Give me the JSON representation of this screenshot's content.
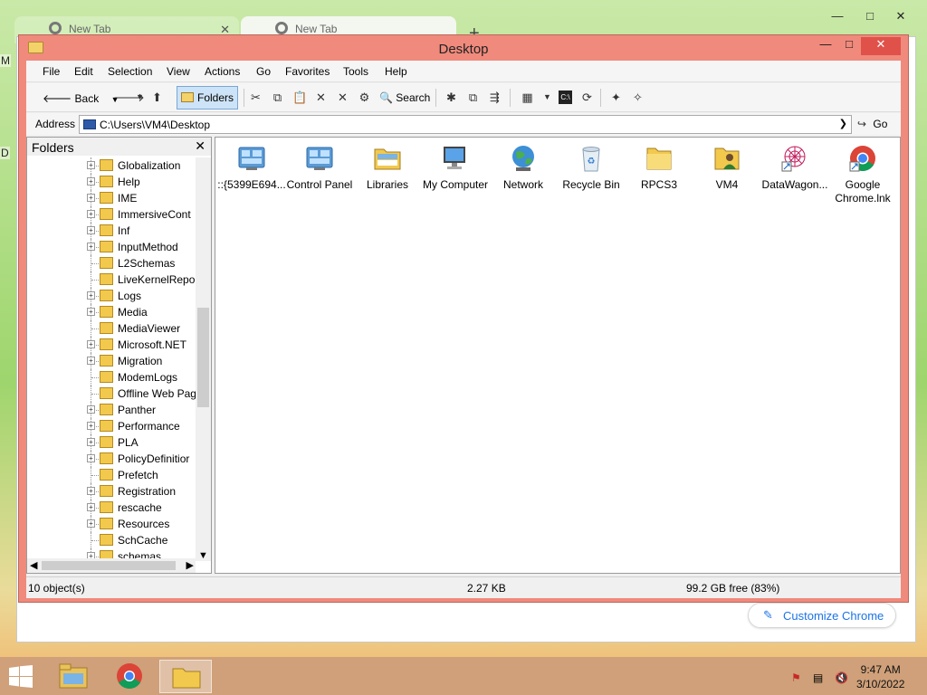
{
  "browser": {
    "tabs": [
      {
        "label": "New Tab"
      },
      {
        "label": "New Tab"
      }
    ],
    "new_tab_symbol": "+",
    "minimize_symbol": "—",
    "maximize_symbol": "□",
    "close_symbol": "✕",
    "dropdown_symbol": "⌄",
    "customize_label": "Customize Chrome"
  },
  "background_fragments": {
    "left_top": "M",
    "left_mid": "D"
  },
  "window": {
    "title": "Desktop",
    "menu": [
      "File",
      "Edit",
      "Selection",
      "View",
      "Actions",
      "Go",
      "Favorites",
      "Tools",
      "Help"
    ],
    "toolbar": {
      "back_label": "Back",
      "folders_label": "Folders",
      "search_label": "Search"
    },
    "address": {
      "label": "Address",
      "value": "C:\\Users\\VM4\\Desktop",
      "go_label": "Go"
    },
    "folders_pane": {
      "title": "Folders",
      "close_symbol": "✕",
      "tree": [
        {
          "label": "Globalization",
          "expandable": true
        },
        {
          "label": "Help",
          "expandable": true
        },
        {
          "label": "IME",
          "expandable": true
        },
        {
          "label": "ImmersiveCont",
          "expandable": true
        },
        {
          "label": "Inf",
          "expandable": true
        },
        {
          "label": "InputMethod",
          "expandable": true
        },
        {
          "label": "L2Schemas",
          "expandable": false
        },
        {
          "label": "LiveKernelRepo",
          "expandable": false
        },
        {
          "label": "Logs",
          "expandable": true
        },
        {
          "label": "Media",
          "expandable": true
        },
        {
          "label": "MediaViewer",
          "expandable": false
        },
        {
          "label": "Microsoft.NET",
          "expandable": true
        },
        {
          "label": "Migration",
          "expandable": true
        },
        {
          "label": "ModemLogs",
          "expandable": false
        },
        {
          "label": "Offline Web Pag",
          "expandable": false
        },
        {
          "label": "Panther",
          "expandable": true
        },
        {
          "label": "Performance",
          "expandable": true
        },
        {
          "label": "PLA",
          "expandable": true
        },
        {
          "label": "PolicyDefinitior",
          "expandable": true
        },
        {
          "label": "Prefetch",
          "expandable": false
        },
        {
          "label": "Registration",
          "expandable": true
        },
        {
          "label": "rescache",
          "expandable": true
        },
        {
          "label": "Resources",
          "expandable": true
        },
        {
          "label": "SchCache",
          "expandable": false
        },
        {
          "label": "schemas",
          "expandable": true
        }
      ]
    },
    "items": [
      {
        "label": "::{5399E694...",
        "icon": "control-panel-icon"
      },
      {
        "label": "Control Panel",
        "icon": "control-panel-icon"
      },
      {
        "label": "Libraries",
        "icon": "libraries-icon"
      },
      {
        "label": "My Computer",
        "icon": "computer-icon"
      },
      {
        "label": "Network",
        "icon": "network-icon"
      },
      {
        "label": "Recycle Bin",
        "icon": "recycle-bin-icon"
      },
      {
        "label": "RPCS3",
        "icon": "folder-icon"
      },
      {
        "label": "VM4",
        "icon": "user-folder-icon"
      },
      {
        "label": "DataWagon...",
        "icon": "shortcut-icon"
      },
      {
        "label": "Google Chrome.lnk",
        "icon": "chrome-icon"
      }
    ],
    "status": {
      "objects": "10 object(s)",
      "size": "2.27 KB",
      "free": "99.2 GB free (83%)"
    }
  },
  "taskbar": {
    "time": "9:47 AM",
    "date": "3/10/2022"
  },
  "colors": {
    "window_frame": "#f08a7c",
    "close_button": "#e0514a",
    "chrome_accent": "#1a73e8",
    "taskbar": "#cfa079",
    "folder": "#f2c94c"
  }
}
